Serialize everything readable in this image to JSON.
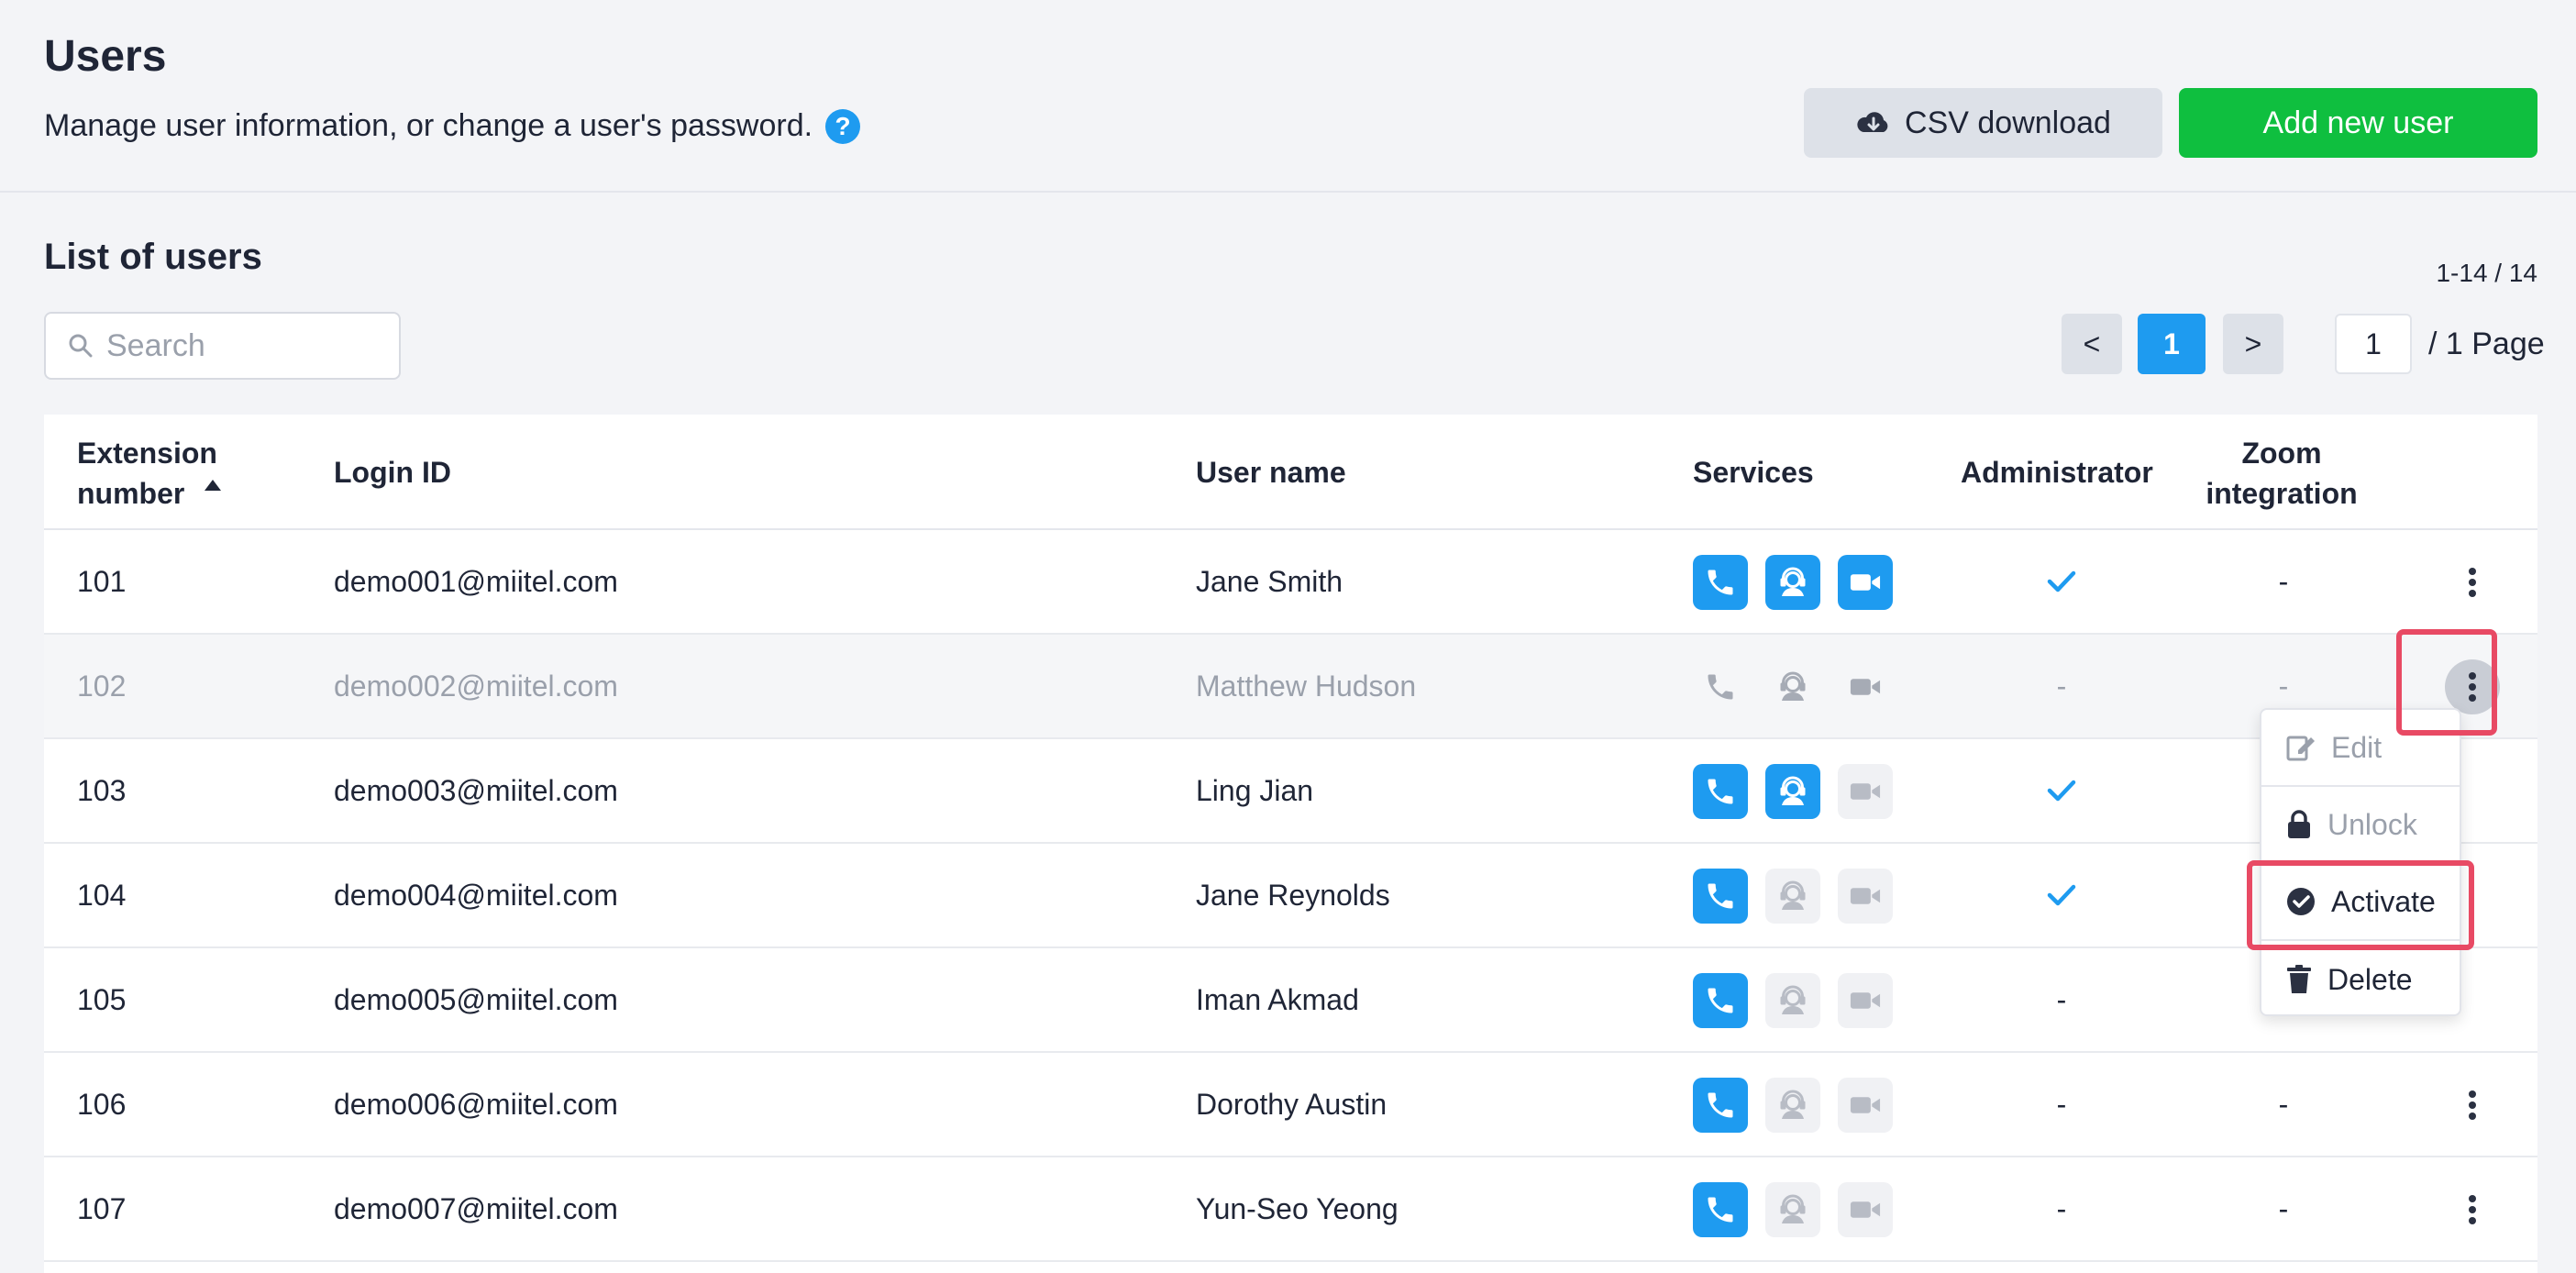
{
  "header": {
    "title": "Users",
    "subtitle": "Manage user information, or change a user's password.",
    "help_icon": "?",
    "csv_button": "CSV download",
    "add_button": "Add new user"
  },
  "list": {
    "title": "List of users",
    "count": "1-14 / 14",
    "search_placeholder": "Search"
  },
  "pagination": {
    "prev": "<",
    "current": "1",
    "next": ">",
    "page_input": "1",
    "total": "/ 1 Page"
  },
  "table": {
    "headers": {
      "extension_line1": "Extension",
      "extension_line2": "number",
      "login_id": "Login ID",
      "user_name": "User name",
      "services": "Services",
      "administrator": "Administrator",
      "zoom_line1": "Zoom",
      "zoom_line2": "integration"
    },
    "rows": [
      {
        "ext": "101",
        "login": "demo001@miitel.com",
        "name": "Jane Smith",
        "phone": true,
        "agent": true,
        "video": true,
        "admin": true,
        "zoom": "-",
        "status": "active"
      },
      {
        "ext": "102",
        "login": "demo002@miitel.com",
        "name": "Matthew Hudson",
        "phone": false,
        "agent": false,
        "video": false,
        "admin": false,
        "zoom": "-",
        "status": "inactive"
      },
      {
        "ext": "103",
        "login": "demo003@miitel.com",
        "name": "Ling Jian",
        "phone": true,
        "agent": true,
        "video": false,
        "admin": true,
        "zoom": "",
        "status": "active"
      },
      {
        "ext": "104",
        "login": "demo004@miitel.com",
        "name": "Jane Reynolds",
        "phone": true,
        "agent": false,
        "video": false,
        "admin": true,
        "zoom": "",
        "status": "active"
      },
      {
        "ext": "105",
        "login": "demo005@miitel.com",
        "name": "Iman Akmad",
        "phone": true,
        "agent": false,
        "video": false,
        "admin": false,
        "zoom": "",
        "status": "active"
      },
      {
        "ext": "106",
        "login": "demo006@miitel.com",
        "name": "Dorothy Austin",
        "phone": true,
        "agent": false,
        "video": false,
        "admin": false,
        "zoom": "-",
        "status": "active"
      },
      {
        "ext": "107",
        "login": "demo007@miitel.com",
        "name": "Yun-Seo Yeong",
        "phone": true,
        "agent": false,
        "video": false,
        "admin": false,
        "zoom": "-",
        "status": "active"
      }
    ],
    "admin_false_text": "-"
  },
  "menu": {
    "edit": "Edit",
    "unlock": "Unlock",
    "activate": "Activate",
    "delete": "Delete"
  },
  "colors": {
    "accent": "#1e9bf0",
    "add_button": "#0fbf3f",
    "highlight": "#e84a64"
  }
}
